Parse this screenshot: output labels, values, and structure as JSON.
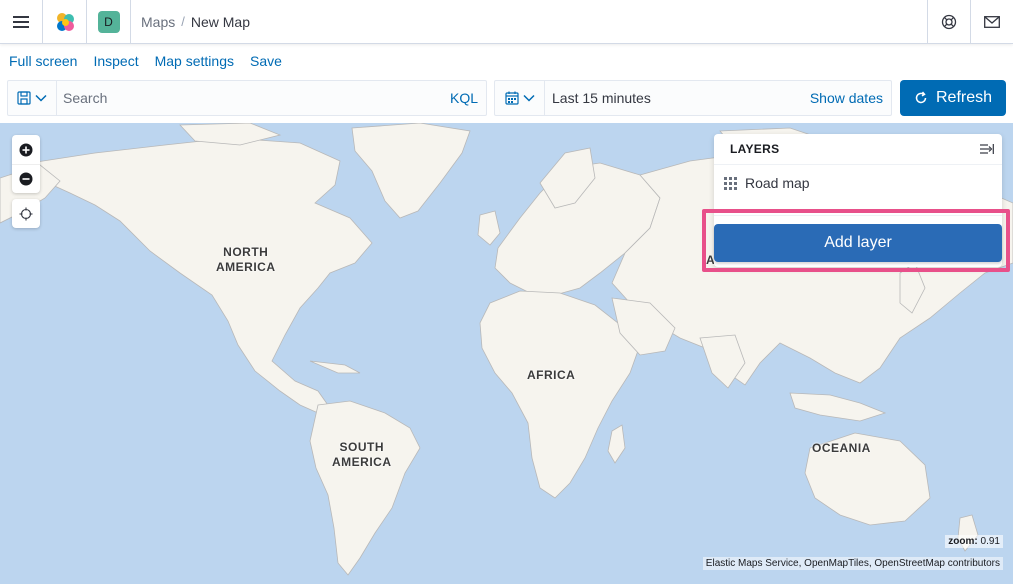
{
  "header": {
    "space_initial": "D",
    "breadcrumbs": [
      "Maps",
      "New Map"
    ]
  },
  "topnav": {
    "items": [
      "Full screen",
      "Inspect",
      "Map settings",
      "Save"
    ]
  },
  "querybar": {
    "placeholder": "Search",
    "language": "KQL"
  },
  "datebar": {
    "label": "Last 15 minutes",
    "show_dates": "Show dates"
  },
  "refresh": {
    "label": "Refresh"
  },
  "map": {
    "continents": {
      "north_america": "NORTH\nAMERICA",
      "south_america": "SOUTH\nAMERICA",
      "africa": "AFRICA",
      "asia": "ASIA",
      "oceania": "OCEANIA"
    },
    "zoom_label": "zoom:",
    "zoom_value": "0.91",
    "attribution": "Elastic Maps Service, OpenMapTiles, OpenStreetMap contributors"
  },
  "layers": {
    "title": "LAYERS",
    "items": [
      {
        "name": "Road map",
        "icon": "grid-icon"
      }
    ],
    "add_label": "Add layer"
  },
  "colors": {
    "accent": "#006bb4",
    "ocean": "#bcd5ef",
    "land": "#f6f4ee",
    "highlight": "#e8508a"
  }
}
